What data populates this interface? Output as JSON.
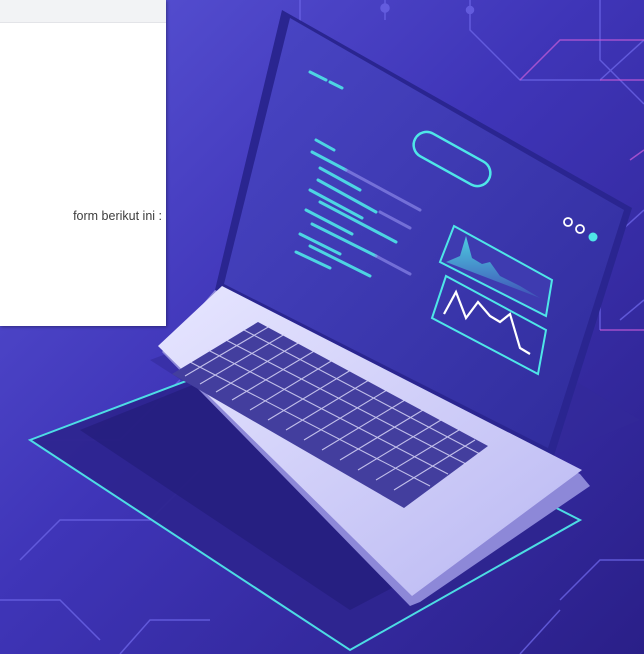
{
  "colors": {
    "background_dark": "#2b1f86",
    "background_light": "#4f46cf",
    "neon_cyan": "#4fe6e8",
    "neon_pink": "#e04fd0",
    "laptop_body": "#d8d6f8",
    "keyboard": "#3f3a9c",
    "screen": "#3b3aa8",
    "panel_bg": "#ffffff"
  },
  "panel": {
    "text": "form berikut ini :"
  },
  "screen": {
    "window_dots": [
      "dot-white",
      "dot-white",
      "dot-cyan"
    ]
  }
}
